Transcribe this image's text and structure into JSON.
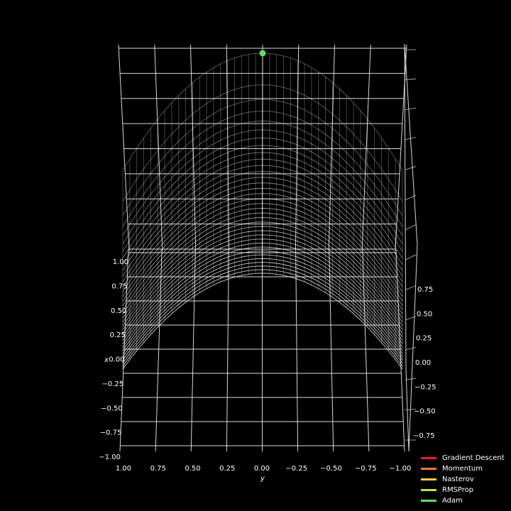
{
  "chart_data": {
    "type": "surface3d",
    "title": "",
    "xlabel": "x",
    "ylabel": "y",
    "zlabel": "",
    "x_ticks": [
      "1.00",
      "0.75",
      "0.50",
      "0.25",
      "0.00",
      "−0.25",
      "−0.50",
      "−0.75",
      "−1.00"
    ],
    "y_ticks": [
      "1.00",
      "0.75",
      "0.50",
      "0.25",
      "0.00",
      "−0.25",
      "−0.50",
      "−0.75",
      "−1.00"
    ],
    "z_ticks": [
      "0.75",
      "0.50",
      "0.25",
      "0.00",
      "−0.25",
      "−0.50",
      "−0.75"
    ],
    "xlim": [
      -1,
      1
    ],
    "ylim": [
      -1,
      1
    ],
    "surface": {
      "function": "z = x^2 - y^2",
      "style": "wireframe",
      "color": "#ffffff"
    },
    "current_point": {
      "x": 0.0,
      "y": 0.0,
      "z": 0.0,
      "color": "#5fe05f"
    },
    "grid": true,
    "background": "#000000",
    "legend_position": "bottom-right",
    "series": [
      {
        "name": "Gradient Descent",
        "color": "#e8202a"
      },
      {
        "name": "Momentum",
        "color": "#f07b2f"
      },
      {
        "name": "Nasterov",
        "color": "#f5d23c"
      },
      {
        "name": "RMSProp",
        "color": "#b4e84a"
      },
      {
        "name": "Adam",
        "color": "#5fe05f"
      }
    ]
  }
}
